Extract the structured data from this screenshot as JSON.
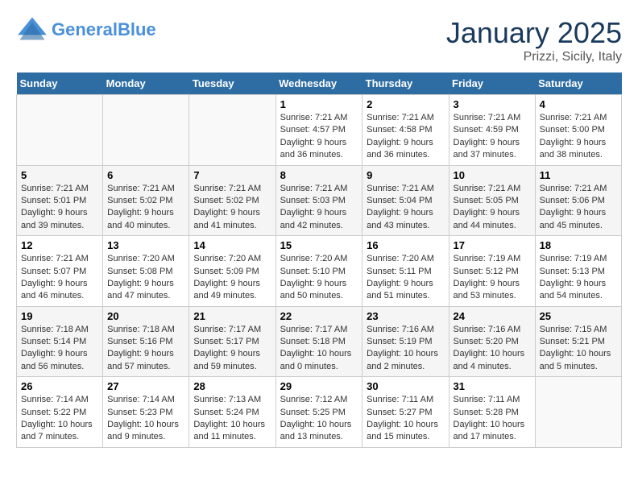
{
  "logo": {
    "line1": "General",
    "line2": "Blue"
  },
  "title": "January 2025",
  "subtitle": "Prizzi, Sicily, Italy",
  "days_of_week": [
    "Sunday",
    "Monday",
    "Tuesday",
    "Wednesday",
    "Thursday",
    "Friday",
    "Saturday"
  ],
  "weeks": [
    [
      {
        "day": "",
        "info": ""
      },
      {
        "day": "",
        "info": ""
      },
      {
        "day": "",
        "info": ""
      },
      {
        "day": "1",
        "info": "Sunrise: 7:21 AM\nSunset: 4:57 PM\nDaylight: 9 hours and 36 minutes."
      },
      {
        "day": "2",
        "info": "Sunrise: 7:21 AM\nSunset: 4:58 PM\nDaylight: 9 hours and 36 minutes."
      },
      {
        "day": "3",
        "info": "Sunrise: 7:21 AM\nSunset: 4:59 PM\nDaylight: 9 hours and 37 minutes."
      },
      {
        "day": "4",
        "info": "Sunrise: 7:21 AM\nSunset: 5:00 PM\nDaylight: 9 hours and 38 minutes."
      }
    ],
    [
      {
        "day": "5",
        "info": "Sunrise: 7:21 AM\nSunset: 5:01 PM\nDaylight: 9 hours and 39 minutes."
      },
      {
        "day": "6",
        "info": "Sunrise: 7:21 AM\nSunset: 5:02 PM\nDaylight: 9 hours and 40 minutes."
      },
      {
        "day": "7",
        "info": "Sunrise: 7:21 AM\nSunset: 5:02 PM\nDaylight: 9 hours and 41 minutes."
      },
      {
        "day": "8",
        "info": "Sunrise: 7:21 AM\nSunset: 5:03 PM\nDaylight: 9 hours and 42 minutes."
      },
      {
        "day": "9",
        "info": "Sunrise: 7:21 AM\nSunset: 5:04 PM\nDaylight: 9 hours and 43 minutes."
      },
      {
        "day": "10",
        "info": "Sunrise: 7:21 AM\nSunset: 5:05 PM\nDaylight: 9 hours and 44 minutes."
      },
      {
        "day": "11",
        "info": "Sunrise: 7:21 AM\nSunset: 5:06 PM\nDaylight: 9 hours and 45 minutes."
      }
    ],
    [
      {
        "day": "12",
        "info": "Sunrise: 7:21 AM\nSunset: 5:07 PM\nDaylight: 9 hours and 46 minutes."
      },
      {
        "day": "13",
        "info": "Sunrise: 7:20 AM\nSunset: 5:08 PM\nDaylight: 9 hours and 47 minutes."
      },
      {
        "day": "14",
        "info": "Sunrise: 7:20 AM\nSunset: 5:09 PM\nDaylight: 9 hours and 49 minutes."
      },
      {
        "day": "15",
        "info": "Sunrise: 7:20 AM\nSunset: 5:10 PM\nDaylight: 9 hours and 50 minutes."
      },
      {
        "day": "16",
        "info": "Sunrise: 7:20 AM\nSunset: 5:11 PM\nDaylight: 9 hours and 51 minutes."
      },
      {
        "day": "17",
        "info": "Sunrise: 7:19 AM\nSunset: 5:12 PM\nDaylight: 9 hours and 53 minutes."
      },
      {
        "day": "18",
        "info": "Sunrise: 7:19 AM\nSunset: 5:13 PM\nDaylight: 9 hours and 54 minutes."
      }
    ],
    [
      {
        "day": "19",
        "info": "Sunrise: 7:18 AM\nSunset: 5:14 PM\nDaylight: 9 hours and 56 minutes."
      },
      {
        "day": "20",
        "info": "Sunrise: 7:18 AM\nSunset: 5:16 PM\nDaylight: 9 hours and 57 minutes."
      },
      {
        "day": "21",
        "info": "Sunrise: 7:17 AM\nSunset: 5:17 PM\nDaylight: 9 hours and 59 minutes."
      },
      {
        "day": "22",
        "info": "Sunrise: 7:17 AM\nSunset: 5:18 PM\nDaylight: 10 hours and 0 minutes."
      },
      {
        "day": "23",
        "info": "Sunrise: 7:16 AM\nSunset: 5:19 PM\nDaylight: 10 hours and 2 minutes."
      },
      {
        "day": "24",
        "info": "Sunrise: 7:16 AM\nSunset: 5:20 PM\nDaylight: 10 hours and 4 minutes."
      },
      {
        "day": "25",
        "info": "Sunrise: 7:15 AM\nSunset: 5:21 PM\nDaylight: 10 hours and 5 minutes."
      }
    ],
    [
      {
        "day": "26",
        "info": "Sunrise: 7:14 AM\nSunset: 5:22 PM\nDaylight: 10 hours and 7 minutes."
      },
      {
        "day": "27",
        "info": "Sunrise: 7:14 AM\nSunset: 5:23 PM\nDaylight: 10 hours and 9 minutes."
      },
      {
        "day": "28",
        "info": "Sunrise: 7:13 AM\nSunset: 5:24 PM\nDaylight: 10 hours and 11 minutes."
      },
      {
        "day": "29",
        "info": "Sunrise: 7:12 AM\nSunset: 5:25 PM\nDaylight: 10 hours and 13 minutes."
      },
      {
        "day": "30",
        "info": "Sunrise: 7:11 AM\nSunset: 5:27 PM\nDaylight: 10 hours and 15 minutes."
      },
      {
        "day": "31",
        "info": "Sunrise: 7:11 AM\nSunset: 5:28 PM\nDaylight: 10 hours and 17 minutes."
      },
      {
        "day": "",
        "info": ""
      }
    ]
  ]
}
